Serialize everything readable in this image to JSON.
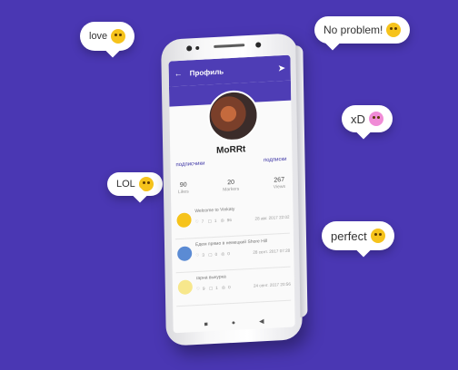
{
  "bubbles": {
    "love": "love",
    "no_problem": "No problem!",
    "xd": "xD",
    "lol": "LOL",
    "perfect": "perfect"
  },
  "app": {
    "title": "Профиль",
    "username": "MoRRt",
    "subscribers_link": "подписчики",
    "subscriptions_link": "подписки",
    "stats": [
      {
        "value": "90",
        "label": "Likes"
      },
      {
        "value": "20",
        "label": "Markers"
      },
      {
        "value": "267",
        "label": "Views"
      }
    ],
    "feed": [
      {
        "text": "Welcome to Vinkaty",
        "likes": "7",
        "comments": "1",
        "views": "96",
        "date": "28 авг. 2017 22:02"
      },
      {
        "text": "Едем прямо в немецкий Shore Hill",
        "likes": "3",
        "comments": "0",
        "views": "0",
        "date": "28 сент. 2017 07:28"
      },
      {
        "text": "гарна выкуpка",
        "likes": "9",
        "comments": "1",
        "views": "0",
        "date": "24 сент. 2017 20:56"
      }
    ]
  }
}
